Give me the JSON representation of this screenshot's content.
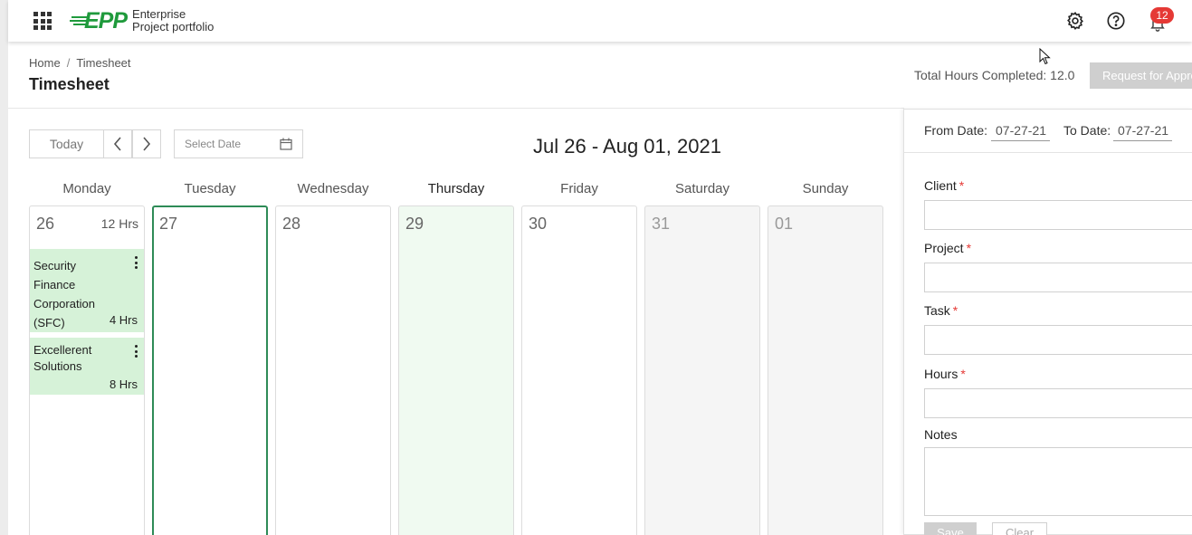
{
  "app": {
    "logo_mark": "EPP",
    "logo_line1": "Enterprise",
    "logo_line2": "Project portfolio",
    "notification_count": "12"
  },
  "header": {
    "breadcrumb_home": "Home",
    "breadcrumb_sep": "/",
    "breadcrumb_current": "Timesheet",
    "title": "Timesheet",
    "total_hours": "Total Hours Completed: 12.0",
    "approval_button": "Request for Approval"
  },
  "toolbar": {
    "today_label": "Today",
    "date_placeholder": "Select Date",
    "range_title": "Jul 26 - Aug 01, 2021"
  },
  "days": [
    {
      "name": "Monday",
      "date": "26",
      "hours": "12 Hrs"
    },
    {
      "name": "Tuesday",
      "date": "27"
    },
    {
      "name": "Wednesday",
      "date": "28"
    },
    {
      "name": "Thursday",
      "date": "29"
    },
    {
      "name": "Friday",
      "date": "30"
    },
    {
      "name": "Saturday",
      "date": "31"
    },
    {
      "name": "Sunday",
      "date": "01"
    }
  ],
  "entries": [
    {
      "client_lines": [
        "Security",
        "Finance",
        "Corporation",
        "(SFC)"
      ],
      "hours": "4 Hrs"
    },
    {
      "client_lines": [
        "Excellerent",
        "Solutions"
      ],
      "hours": "8 Hrs"
    }
  ],
  "panel": {
    "from_label": "From Date:",
    "from_value": "07-27-21",
    "to_label": "To Date:",
    "to_value": "07-27-21",
    "client_label": "Client",
    "project_label": "Project",
    "task_label": "Task",
    "hours_label": "Hours",
    "notes_label": "Notes",
    "required_mark": "*",
    "save_label": "Save",
    "clear_label": "Clear"
  },
  "colors": {
    "brand_green": "#1f9a3c",
    "entry_bg": "#d6f2d8",
    "selected_border": "#2e8b57",
    "badge_red": "#e53935"
  },
  "icons": [
    "apps-grid-icon",
    "gear-icon",
    "help-icon",
    "bell-icon",
    "chevron-left-icon",
    "chevron-right-icon",
    "calendar-icon",
    "kebab-menu-icon"
  ]
}
